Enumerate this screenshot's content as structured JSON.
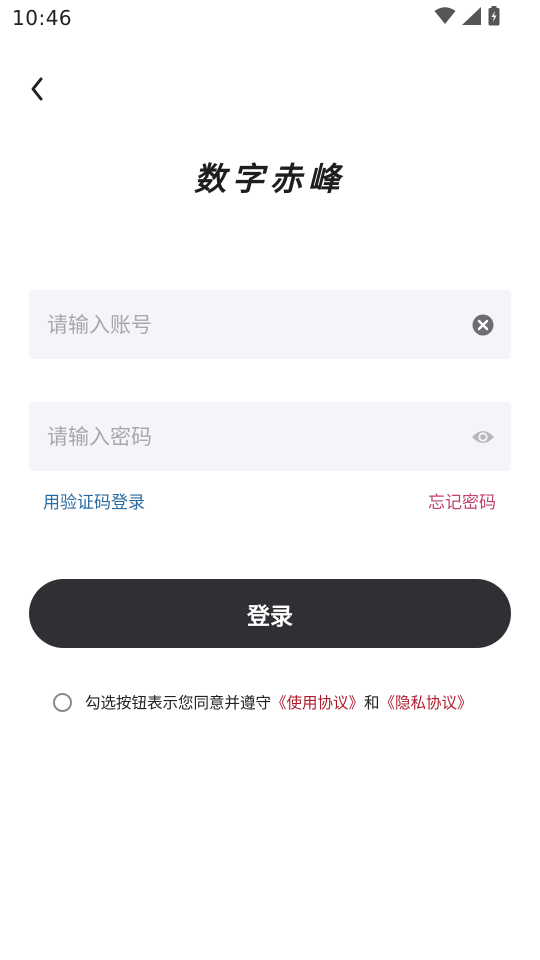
{
  "status_bar": {
    "time": "10:46",
    "icons": [
      "wifi-icon",
      "signal-icon",
      "battery-charging-icon"
    ]
  },
  "header": {
    "back_icon": "chevron-left-icon"
  },
  "logo": {
    "text": "数字赤峰"
  },
  "account_input": {
    "placeholder": "请输入账号",
    "value": "",
    "trailing_icon": "clear-icon"
  },
  "password_input": {
    "placeholder": "请输入密码",
    "value": "",
    "trailing_icon": "eye-icon"
  },
  "links": {
    "sms_login": "用验证码登录",
    "forgot_password": "忘记密码"
  },
  "login_button": {
    "label": "登录"
  },
  "agreement": {
    "checked": false,
    "prefix": "勾选按钮表示您同意并遵守",
    "user_agreement": "《使用协议》",
    "conjunction": "和",
    "privacy_policy": "《隐私协议》"
  },
  "colors": {
    "input_bg": "#f4f5f9",
    "button_bg": "#2f3033",
    "sms_link": "#2b6ca3",
    "forgot_link": "#c2416b",
    "agreement_link": "#b01c2e"
  }
}
